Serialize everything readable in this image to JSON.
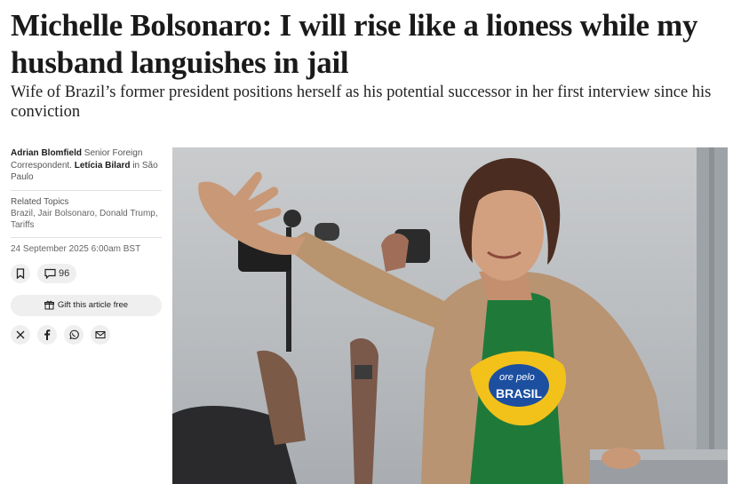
{
  "article": {
    "headline": "Michelle Bolsonaro: I will rise like a lioness while my husband languishes in jail",
    "standfirst": "Wife of Brazil’s former president positions herself as his potential successor in her first interview since his conviction"
  },
  "byline": {
    "author1": "Adrian Blomfield",
    "author1_role": "Senior Foreign Correspondent.",
    "author2": "Letícia Bilard",
    "author2_location": "in São Paulo"
  },
  "related": {
    "label": "Related Topics",
    "topics": "Brazil, Jair Bolsonaro, Donald Trump, Tariffs"
  },
  "published": "24 September 2025 6:00am BST",
  "actions": {
    "comment_count": "96",
    "gift_label": "Gift this article free",
    "bookmark_icon": "bookmark-icon",
    "comment_icon": "speech-bubble-icon",
    "gift_icon": "gift-icon"
  },
  "share": {
    "icons": [
      "x-icon",
      "facebook-icon",
      "whatsapp-icon",
      "email-icon"
    ]
  },
  "photo": {
    "tshirt_text_line1": "ore pelo",
    "tshirt_text_line2": "BRASIL"
  }
}
